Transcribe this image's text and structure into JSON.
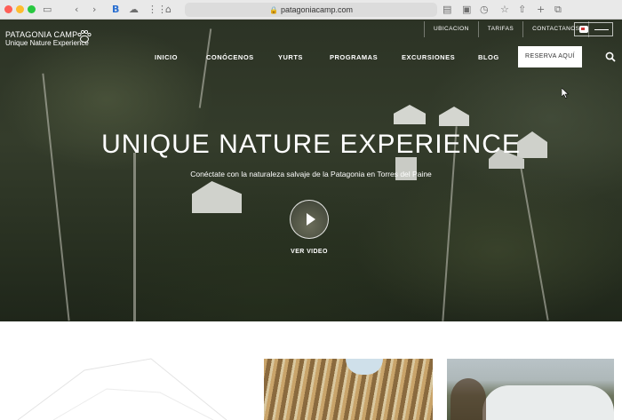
{
  "browser": {
    "url": "patagoniacamp.com",
    "colors": {
      "close": "#fe5f57",
      "minimize": "#febc2e",
      "maximize": "#28c840"
    }
  },
  "logo": {
    "name": "PATAGONIA CAMP",
    "tagline": "Unique Nature Experience"
  },
  "utility_nav": [
    "UBICACION",
    "TARIFAS",
    "CONTACTANOS"
  ],
  "main_nav": [
    "INICIO",
    "CONÓCENOS",
    "YURTS",
    "PROGRAMAS",
    "EXCURSIONES",
    "BLOG"
  ],
  "reserve_button": "RESERVA AQUÍ",
  "hero": {
    "headline": "UNIQUE NATURE EXPERIENCE",
    "subheadline": "Conéctate con la naturaleza salvaje de la Patagonia en Torres del Paine",
    "video_label": "VER VIDEO"
  }
}
